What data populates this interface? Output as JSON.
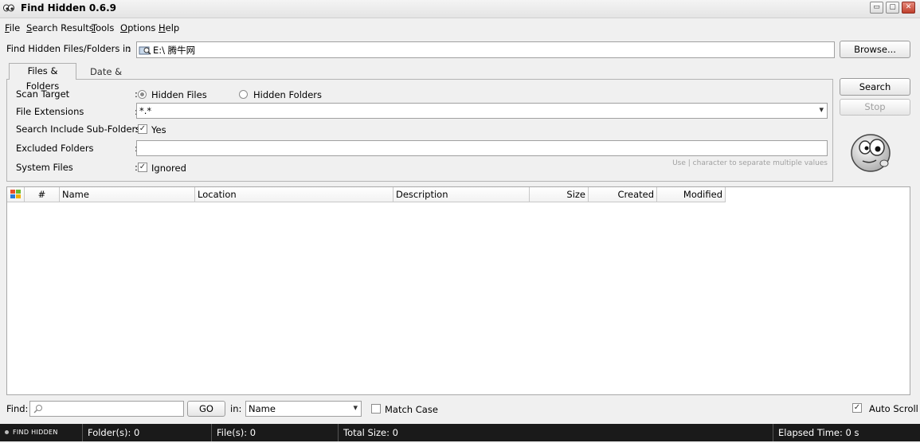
{
  "window": {
    "title": "Find Hidden 0.6.9",
    "minimize_glyph": "▭",
    "maximize_glyph": "▢",
    "close_glyph": "✕"
  },
  "menu": {
    "file": {
      "accel": "F",
      "rest": "ile"
    },
    "search_results": {
      "accel": "S",
      "rest": "earch Results"
    },
    "tools": {
      "accel": "T",
      "rest": "ools"
    },
    "options": {
      "accel": "O",
      "rest": "ptions"
    },
    "help": {
      "accel": "H",
      "rest": "elp"
    }
  },
  "location": {
    "label": "Find Hidden Files/Folders in",
    "colon": ":",
    "value": "E:\\ 腾牛网",
    "browse_label": "Browse..."
  },
  "tabs": {
    "files_folders": "Files & Folders",
    "date_size": "Date & Size"
  },
  "form": {
    "colon": ":",
    "scan_target_label": "Scan Target",
    "hidden_files_label": "Hidden Files",
    "hidden_folders_label": "Hidden Folders",
    "hidden_files_selected": true,
    "file_extensions_label": "File Extensions",
    "file_extensions_value": "*.*",
    "dropdown_glyph": "▾",
    "subfolders_label": "Search Include Sub-Folders",
    "subfolders_value": "Yes",
    "excluded_label": "Excluded Folders",
    "excluded_value": "",
    "system_files_label": "System Files",
    "system_files_value": "Ignored",
    "hint": "Use | character to separate multiple values",
    "check_glyph": "✓"
  },
  "actions": {
    "search_label": "Search",
    "stop_label": "Stop"
  },
  "table": {
    "columns": {
      "num": "#",
      "name": "Name",
      "location": "Location",
      "description": "Description",
      "size": "Size",
      "created": "Created",
      "modified": "Modified"
    },
    "rows": []
  },
  "find": {
    "label": "Find:",
    "value": "",
    "go_label": "GO",
    "in_label": "in:",
    "in_value": "Name",
    "match_case_label": "Match Case",
    "match_case_checked": false,
    "auto_scroll_label": "Auto Scroll",
    "auto_scroll_checked": true
  },
  "status": {
    "app_name": "FIND HIDDEN",
    "folders": "Folder(s): 0",
    "files": "File(s): 0",
    "total_size": "Total Size: 0",
    "elapsed": "Elapsed Time: 0 s"
  }
}
